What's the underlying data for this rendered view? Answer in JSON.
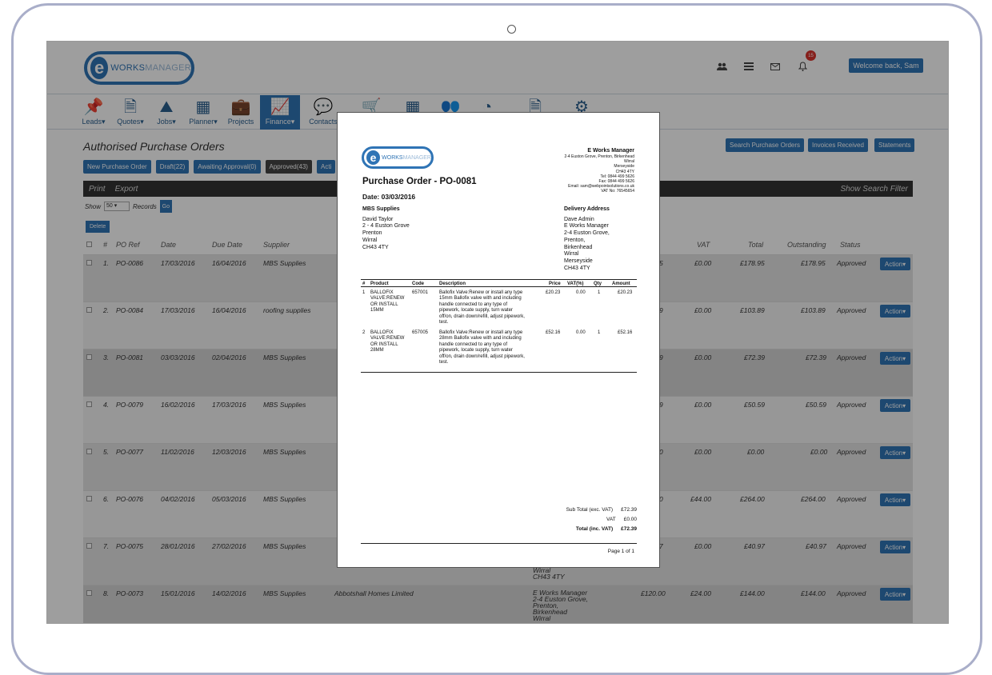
{
  "header": {
    "logo_e": "e",
    "logo_works": "WORKS",
    "logo_manager": "MANAGER",
    "icons": [
      "users-icon",
      "list-icon",
      "mail-icon",
      "bell-icon"
    ],
    "notification_count": "15",
    "welcome_label": "Welcome back, Sam"
  },
  "nav": {
    "items": [
      {
        "label": "Leads▾",
        "icon": "pin-icon"
      },
      {
        "label": "Quotes▾",
        "icon": "document-icon"
      },
      {
        "label": "Jobs▾",
        "icon": "road-icon"
      },
      {
        "label": "Planner▾",
        "icon": "calendar-icon"
      },
      {
        "label": "Projects",
        "icon": "briefcase-icon"
      },
      {
        "label": "Finance▾",
        "icon": "chart-icon"
      },
      {
        "label": "Contacts",
        "icon": "chat-icon"
      }
    ]
  },
  "page": {
    "title": "Authorised Purchase Orders",
    "buttons": [
      "New Purchase Order",
      "Draft(22)",
      "Awaiting Approval(0)",
      "Approved(43)",
      "Acti"
    ],
    "right_buttons": [
      "Search Purchase Orders",
      "Invoices Received",
      "Statements"
    ],
    "toolbar": {
      "print": "Print",
      "export": "Export",
      "search_filter": "Show Search Filter"
    },
    "show_label": "Show",
    "show_value": "50",
    "records_label": "Records",
    "go_label": "Go",
    "delete_label": "Delete"
  },
  "table": {
    "headers": {
      "num": "#",
      "po": "PO Ref",
      "date": "Date",
      "due": "Due Date",
      "supplier": "Supplier",
      "vat": "VAT",
      "total": "Total",
      "outstanding": "Outstanding",
      "status": "Status"
    },
    "rows": [
      {
        "num": "1.",
        "po": "PO-0086",
        "date": "17/03/2016",
        "due": "16/04/2016",
        "supplier": "MBS Supplies",
        "frag": "5",
        "vat": "£0.00",
        "total": "£178.95",
        "outstanding": "£178.95",
        "status": "Approved"
      },
      {
        "num": "2.",
        "po": "PO-0084",
        "date": "17/03/2016",
        "due": "16/04/2016",
        "supplier": "roofing supplies",
        "frag": "9",
        "vat": "£0.00",
        "total": "£103.89",
        "outstanding": "£103.89",
        "status": "Approved"
      },
      {
        "num": "3.",
        "po": "PO-0081",
        "date": "03/03/2016",
        "due": "02/04/2016",
        "supplier": "MBS Supplies",
        "frag": "9",
        "vat": "£0.00",
        "total": "£72.39",
        "outstanding": "£72.39",
        "status": "Approved"
      },
      {
        "num": "4.",
        "po": "PO-0079",
        "date": "16/02/2016",
        "due": "17/03/2016",
        "supplier": "MBS Supplies",
        "frag": "9",
        "vat": "£0.00",
        "total": "£50.59",
        "outstanding": "£50.59",
        "status": "Approved"
      },
      {
        "num": "5.",
        "po": "PO-0077",
        "date": "11/02/2016",
        "due": "12/03/2016",
        "supplier": "MBS Supplies",
        "frag": "0",
        "vat": "£0.00",
        "total": "£0.00",
        "outstanding": "£0.00",
        "status": "Approved"
      },
      {
        "num": "6.",
        "po": "PO-0076",
        "date": "04/02/2016",
        "due": "05/03/2016",
        "supplier": "MBS Supplies",
        "frag": "0",
        "vat": "£44.00",
        "total": "£264.00",
        "outstanding": "£264.00",
        "status": "Approved"
      },
      {
        "num": "7.",
        "po": "PO-0075",
        "date": "28/01/2016",
        "due": "27/02/2016",
        "supplier": "MBS Supplies",
        "frag": "7",
        "vat": "£0.00",
        "total": "£40.97",
        "outstanding": "£40.97",
        "status": "Approved"
      },
      {
        "num": "8.",
        "po": "PO-0073",
        "date": "15/01/2016",
        "due": "14/02/2016",
        "supplier": "MBS Supplies",
        "frag": "£120.00",
        "vat": "£24.00",
        "total": "£144.00",
        "outstanding": "£144.00",
        "status": "Approved"
      }
    ],
    "action_label": "Action▾",
    "row7_extra": [
      "Wirral",
      "CH43 4TY"
    ],
    "row8_customer": "Abbotshall Homes Limited",
    "row8_address": [
      "E Works Manager",
      "2-4 Euston Grove,",
      "Prenton,",
      "Birkenhead",
      "Wirral"
    ]
  },
  "document": {
    "logo_e": "e",
    "logo_works": "WORKS",
    "logo_manager": "MANAGER",
    "company": {
      "name": "E Works Manager",
      "lines": [
        "2-4 Euston Grove, Prenton, Birkenhead",
        "Wirral",
        "Merseyside",
        "CH43 4TY",
        "Tel: 0844 499 5626",
        "Fax: 0844 499 5626",
        "Email: sam@webpointsolutions.co.uk",
        "VAT No: 76545654"
      ]
    },
    "title": "Purchase Order - PO-0081",
    "date": "Date: 03/03/2016",
    "supplier": {
      "heading": "MBS Supplies",
      "lines": [
        "David Taylor",
        "2 - 4 Euston Grove",
        "Prenton",
        "Wirral",
        "CH43 4TY"
      ]
    },
    "delivery": {
      "heading": "Delivery Address",
      "lines": [
        "Dave Admin",
        "E Works Manager",
        "2-4 Euston Grove,",
        "Prenton,",
        "Birkenhead",
        "Wirral",
        "Merseyside",
        "CH43 4TY"
      ]
    },
    "table_headers": {
      "num": "#",
      "product": "Product",
      "code": "Code",
      "description": "Description",
      "price": "Price",
      "vat": "VAT(%)",
      "qty": "Qty",
      "amount": "Amount"
    },
    "items": [
      {
        "num": "1",
        "product": [
          "BALLOFIX",
          "VALVE:RENEW",
          "OR INSTALL",
          "15MM"
        ],
        "code": "657001",
        "description": [
          "Ballofix Valve:Renew or install any type",
          "15mm Ballofix valve with and including",
          "handle connected to any type of",
          "pipework, locate supply, turn water",
          "off/on, drain down/refill, adjust pipework,",
          "test."
        ],
        "price": "£20.23",
        "vat": "0.00",
        "qty": "1",
        "amount": "£20.23"
      },
      {
        "num": "2",
        "product": [
          "BALLOFIX",
          "VALVE:RENEW",
          "OR INSTALL",
          "28MM"
        ],
        "code": "657005",
        "description": [
          "Ballofix Valve:Renew or install any type",
          "28mm Ballofix valve with and including",
          "handle connected to any type of",
          "pipework, locate supply, turn water",
          "off/on, drain down/refill, adjust pipework,",
          "test."
        ],
        "price": "£52.16",
        "vat": "0.00",
        "qty": "1",
        "amount": "£52.16"
      }
    ],
    "totals": {
      "subtotal_label": "Sub Total (exc. VAT)",
      "subtotal": "£72.39",
      "vat_label": "VAT",
      "vat": "£0.00",
      "total_label": "Total (inc. VAT)",
      "total": "£72.39"
    },
    "page_label": "Page 1 of 1"
  }
}
